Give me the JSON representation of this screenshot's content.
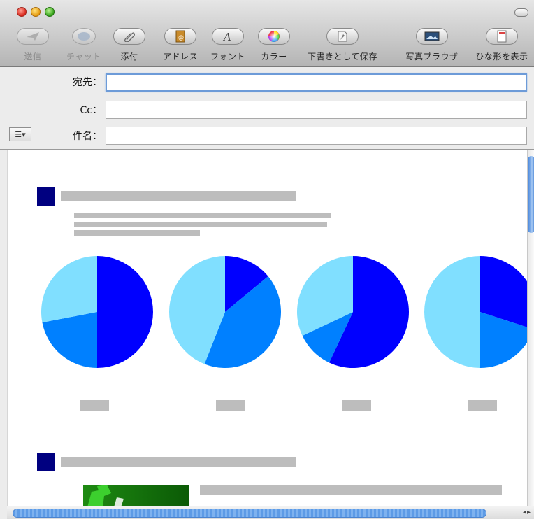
{
  "toolbar": {
    "buttons": [
      {
        "label": "送信",
        "icon": "send-icon",
        "enabled": false
      },
      {
        "label": "チャット",
        "icon": "chat-icon",
        "enabled": false
      },
      {
        "label": "添付",
        "icon": "paperclip-icon",
        "enabled": true
      },
      {
        "label": "アドレス",
        "icon": "address-book-icon",
        "enabled": true
      },
      {
        "label": "フォント",
        "icon": "font-icon",
        "enabled": true
      },
      {
        "label": "カラー",
        "icon": "color-wheel-icon",
        "enabled": true
      },
      {
        "label": "下書きとして保存",
        "icon": "save-draft-icon",
        "enabled": true
      },
      {
        "label": "写真ブラウザ",
        "icon": "photo-browser-icon",
        "enabled": true
      },
      {
        "label": "ひな形を表示",
        "icon": "stationery-icon",
        "enabled": true
      }
    ]
  },
  "header": {
    "to_label": "宛先：",
    "to_value": "",
    "cc_label": "Cc：",
    "cc_value": "",
    "subject_label": "件名：",
    "subject_value": "",
    "format_menu": "☰▾"
  },
  "colors": {
    "pie_dark": "#0000ff",
    "pie_mid": "#0080ff",
    "pie_light": "#80dfff",
    "section_marker": "#000080",
    "placeholder_gray": "#bdbdbd"
  },
  "chart_data": [
    {
      "type": "pie",
      "values": [
        50,
        22,
        28
      ],
      "colors": [
        "#0000ff",
        "#0080ff",
        "#80dfff"
      ]
    },
    {
      "type": "pie",
      "values": [
        14,
        42,
        44
      ],
      "colors": [
        "#0000ff",
        "#0080ff",
        "#80dfff"
      ]
    },
    {
      "type": "pie",
      "values": [
        57,
        11,
        32
      ],
      "colors": [
        "#0000ff",
        "#0080ff",
        "#80dfff"
      ]
    },
    {
      "type": "pie",
      "values": [
        30,
        20,
        50
      ],
      "colors": [
        "#0000ff",
        "#0080ff",
        "#80dfff"
      ]
    }
  ]
}
